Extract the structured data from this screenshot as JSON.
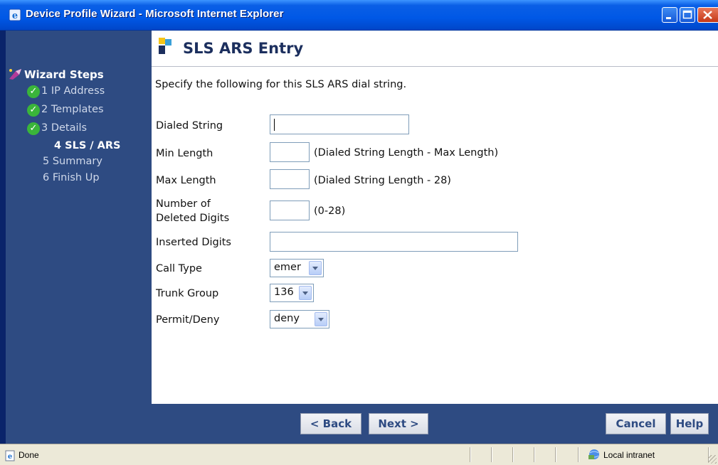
{
  "window": {
    "title": "Device Profile Wizard - Microsoft Internet Explorer"
  },
  "sidebar": {
    "heading": "Wizard Steps",
    "steps": [
      {
        "label": "1 IP Address",
        "state": "done"
      },
      {
        "label": "2 Templates",
        "state": "done"
      },
      {
        "label": "3 Details",
        "state": "done"
      },
      {
        "label": "4 SLS / ARS",
        "state": "current"
      },
      {
        "label": "5 Summary",
        "state": "pending"
      },
      {
        "label": "6 Finish Up",
        "state": "pending"
      }
    ],
    "check_glyph": "✓"
  },
  "page": {
    "title": "SLS ARS Entry",
    "intro": "Specify the following for this SLS ARS dial string."
  },
  "form": {
    "dialed_string": {
      "label": "Dialed String",
      "value": ""
    },
    "min_length": {
      "label": "Min Length",
      "value": "",
      "hint": "(Dialed String Length - Max Length)"
    },
    "max_length": {
      "label": "Max Length",
      "value": "",
      "hint": "(Dialed String Length - 28)"
    },
    "deleted_digits": {
      "label_line1": "Number of",
      "label_line2": "Deleted Digits",
      "value": "",
      "hint": "(0-28)"
    },
    "inserted_digits": {
      "label": "Inserted Digits",
      "value": ""
    },
    "call_type": {
      "label": "Call Type",
      "value": "emer"
    },
    "trunk_group": {
      "label": "Trunk Group",
      "value": "136"
    },
    "permit_deny": {
      "label": "Permit/Deny",
      "value": "deny"
    }
  },
  "buttons": {
    "back": "< Back",
    "next": "Next >",
    "cancel": "Cancel",
    "help": "Help"
  },
  "status": {
    "text": "Done",
    "zone": "Local intranet"
  },
  "icons": {
    "title": "ie-icon",
    "wizard": "wizard-icon",
    "status": "ie-page-icon",
    "zone": "intranet-icon"
  }
}
